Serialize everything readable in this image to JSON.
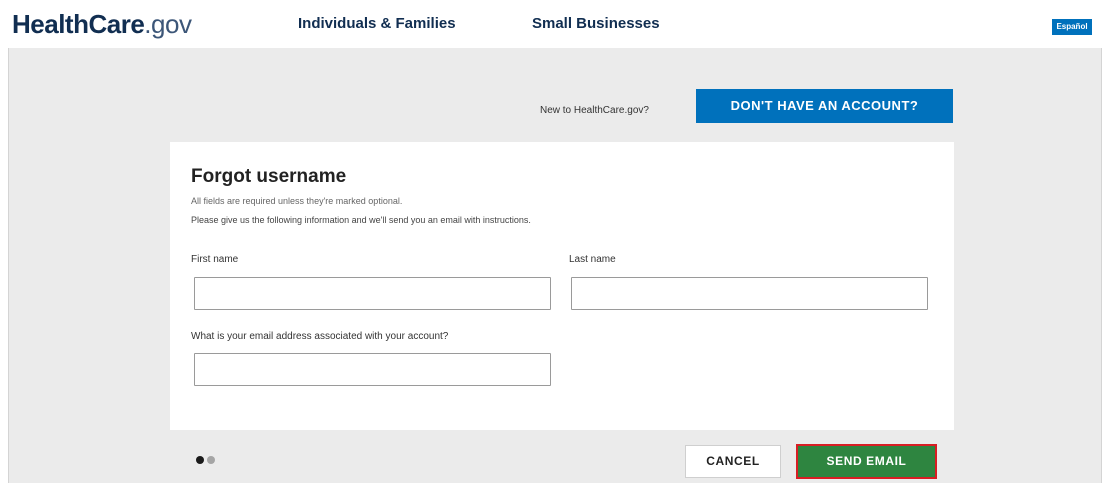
{
  "header": {
    "logo": {
      "part1": "Health",
      "part2": "Care",
      "part3": ".gov"
    },
    "nav": [
      {
        "label": "Individuals & Families"
      },
      {
        "label": "Small Businesses"
      }
    ],
    "language_button": "Español"
  },
  "account_prompt": {
    "text": "New to HealthCare.gov?",
    "button": "DON'T HAVE AN ACCOUNT?"
  },
  "form": {
    "title": "Forgot username",
    "required_note": "All fields are required unless they're marked optional.",
    "instructions": "Please give us the following information and we'll send you an email with instructions.",
    "fields": {
      "first_name": {
        "label": "First name",
        "value": ""
      },
      "last_name": {
        "label": "Last name",
        "value": ""
      },
      "email": {
        "label": "What is your email address associated with your account?",
        "value": ""
      }
    }
  },
  "footer": {
    "steps": {
      "current": 1,
      "total": 2
    },
    "cancel": "CANCEL",
    "send": "SEND EMAIL"
  },
  "colors": {
    "brand_navy": "#112e51",
    "primary_blue": "#0071bc",
    "success_green": "#2e8540",
    "highlight_red": "#d81e24",
    "page_gray": "#ebebeb"
  }
}
